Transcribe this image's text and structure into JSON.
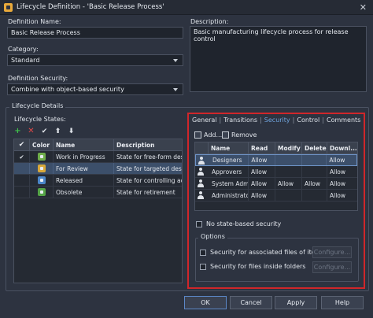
{
  "window": {
    "title": "Lifecycle Definition - 'Basic Release Process'",
    "close_glyph": "✕"
  },
  "definition_name": {
    "label": "Definition Name:",
    "value": "Basic Release Process"
  },
  "description": {
    "label": "Description:",
    "value": "Basic manufacturing lifecycle process for release control"
  },
  "category": {
    "label": "Category:",
    "value": "Standard"
  },
  "definition_security": {
    "label": "Definition Security:",
    "value": "Combine with object-based security"
  },
  "lifecycle_details": {
    "legend": "Lifecycle Details",
    "states_label": "Lifecycle States:",
    "toolbar": [
      "add-icon",
      "delete-icon",
      "check-icon",
      "arrow-up-icon",
      "arrow-down-icon"
    ],
    "columns": [
      "",
      "Color",
      "Name",
      "Description"
    ],
    "rows": [
      {
        "check": "✔",
        "name": "Work in Progress",
        "description": "State for free-form desi...",
        "color": "#6fae4a"
      },
      {
        "check": "",
        "name": "For Review",
        "description": "State for targeted desi...",
        "color": "#d9a93a"
      },
      {
        "check": "",
        "name": "Released",
        "description": "State for controlling acc...",
        "color": "#4b86c9"
      },
      {
        "check": "",
        "name": "Obsolete",
        "description": "State for retirement",
        "color": "#55a447"
      }
    ]
  },
  "tabs": [
    "General",
    "Transitions",
    "Security",
    "Control",
    "Comments"
  ],
  "active_tab": "Security",
  "security": {
    "add_label": "Add...",
    "remove_label": "Remove",
    "columns": [
      "",
      "Name",
      "Read",
      "Modify",
      "Delete",
      "Downl..."
    ],
    "rows": [
      {
        "name": "Designers",
        "read": "Allow",
        "modify": "",
        "delete": "",
        "download": "Allow"
      },
      {
        "name": "Approvers",
        "read": "Allow",
        "modify": "",
        "delete": "",
        "download": "Allow"
      },
      {
        "name": "System Admin",
        "read": "Allow",
        "modify": "Allow",
        "delete": "Allow",
        "download": "Allow"
      },
      {
        "name": "Administrator",
        "read": "Allow",
        "modify": "",
        "delete": "",
        "download": "Allow"
      }
    ],
    "no_state_security_label": "No state-based security",
    "options_legend": "Options",
    "associated_files_label": "Security for associated files of items",
    "inside_folders_label": "Security for files inside folders",
    "configure_label": "Configure..."
  },
  "highlight_color": "#d0262a",
  "buttons": {
    "ok": "OK",
    "cancel": "Cancel",
    "apply": "Apply",
    "help": "Help"
  }
}
